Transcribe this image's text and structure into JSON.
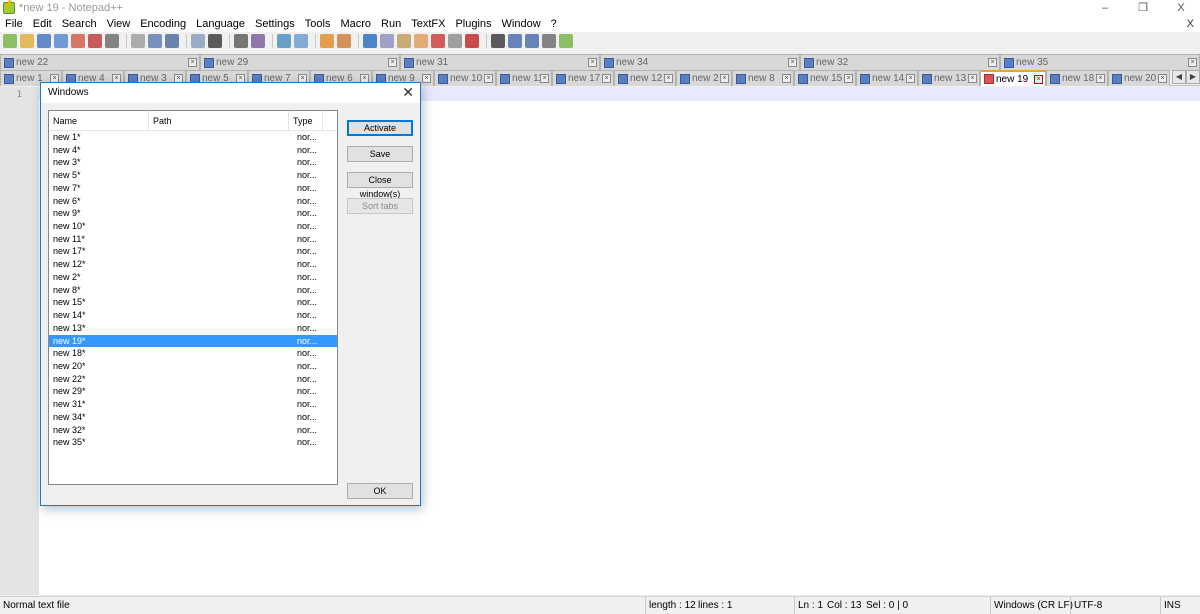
{
  "window": {
    "title": "*new 19 - Notepad++",
    "minimize": "–",
    "restore": "❐",
    "close": "X"
  },
  "menu": {
    "items": [
      "File",
      "Edit",
      "Search",
      "View",
      "Encoding",
      "Language",
      "Settings",
      "Tools",
      "Macro",
      "Run",
      "TextFX",
      "Plugins",
      "Window",
      "?"
    ],
    "close_doc": "X"
  },
  "toolbar": {
    "icons": [
      "new-file-icon",
      "open-file-icon",
      "save-icon",
      "save-all-icon",
      "close-icon",
      "close-all-icon",
      "print-icon",
      "sep",
      "cut-icon",
      "copy-icon",
      "paste-icon",
      "sep",
      "undo-icon",
      "redo-icon",
      "sep",
      "find-icon",
      "replace-icon",
      "sep",
      "zoom-in-icon",
      "zoom-out-icon",
      "sep",
      "sync-vertical-icon",
      "sync-horizontal-icon",
      "sep",
      "word-wrap-icon",
      "show-all-chars-icon",
      "indent-guide-icon",
      "doc-map-icon",
      "function-list-icon",
      "folder-workspace-icon",
      "monitor-icon",
      "sep",
      "record-macro-icon",
      "stop-macro-icon",
      "play-macro-icon",
      "run-macro-multiple-icon",
      "save-macro-icon"
    ]
  },
  "tabs_row1": [
    "new 22",
    "new 29",
    "new 31",
    "new 34",
    "new 32",
    "new 35"
  ],
  "tabs_row2": [
    "new 1",
    "new 4",
    "new 3",
    "new 5",
    "new 7",
    "new 6",
    "new 9",
    "new 10",
    "new 11",
    "new 17",
    "new 12",
    "new 2",
    "new 8",
    "new 15",
    "new 14",
    "new 13",
    "new 19",
    "new 18",
    "new 20"
  ],
  "active_tab": "new 19",
  "editor": {
    "line_number": "1"
  },
  "dialog": {
    "title": "Windows",
    "close": "✕",
    "columns": [
      "Name",
      "Path",
      "Type"
    ],
    "rows": [
      {
        "name": "new 1*",
        "type": "nor..."
      },
      {
        "name": "new 4*",
        "type": "nor..."
      },
      {
        "name": "new 3*",
        "type": "nor..."
      },
      {
        "name": "new 5*",
        "type": "nor..."
      },
      {
        "name": "new 7*",
        "type": "nor..."
      },
      {
        "name": "new 6*",
        "type": "nor..."
      },
      {
        "name": "new 9*",
        "type": "nor..."
      },
      {
        "name": "new 10*",
        "type": "nor..."
      },
      {
        "name": "new 11*",
        "type": "nor..."
      },
      {
        "name": "new 17*",
        "type": "nor..."
      },
      {
        "name": "new 12*",
        "type": "nor..."
      },
      {
        "name": "new 2*",
        "type": "nor..."
      },
      {
        "name": "new 8*",
        "type": "nor..."
      },
      {
        "name": "new 15*",
        "type": "nor..."
      },
      {
        "name": "new 14*",
        "type": "nor..."
      },
      {
        "name": "new 13*",
        "type": "nor..."
      },
      {
        "name": "new 19*",
        "type": "nor...",
        "selected": true
      },
      {
        "name": "new 18*",
        "type": "nor..."
      },
      {
        "name": "new 20*",
        "type": "nor..."
      },
      {
        "name": "new 22*",
        "type": "nor..."
      },
      {
        "name": "new 29*",
        "type": "nor..."
      },
      {
        "name": "new 31*",
        "type": "nor..."
      },
      {
        "name": "new 34*",
        "type": "nor..."
      },
      {
        "name": "new 32*",
        "type": "nor..."
      },
      {
        "name": "new 35*",
        "type": "nor..."
      }
    ],
    "buttons": {
      "activate": "Activate",
      "save": "Save",
      "close_windows": "Close window(s)",
      "sort_tabs": "Sort tabs",
      "ok": "OK"
    }
  },
  "status": {
    "file_type": "Normal text file",
    "length": "length : 12",
    "lines": "lines : 1",
    "ln": "Ln : 1",
    "col": "Col : 13",
    "sel": "Sel : 0 | 0",
    "eol": "Windows (CR LF)",
    "encoding": "UTF-8",
    "mode": "INS"
  },
  "colors": {
    "selection": "#3399ff",
    "active_tab_accent": "#f0a030",
    "dialog_border": "#1979ca"
  }
}
